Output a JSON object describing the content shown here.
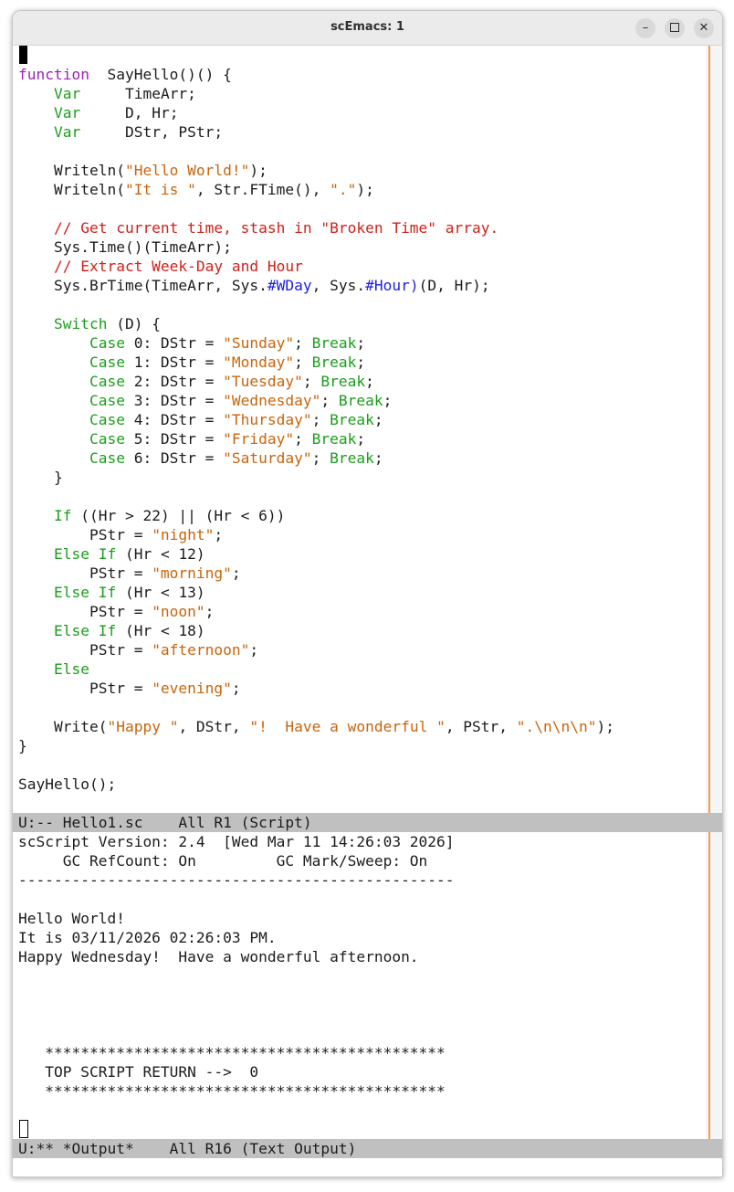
{
  "window": {
    "title": "scEmacs: 1"
  },
  "editor": {
    "lines": [
      [],
      [
        [
          "kw",
          "function"
        ],
        [
          "",
          "  SayHello()() {"
        ]
      ],
      [
        [
          "",
          "    "
        ],
        [
          "ty",
          "Var"
        ],
        [
          "",
          "     TimeArr;"
        ]
      ],
      [
        [
          "",
          "    "
        ],
        [
          "ty",
          "Var"
        ],
        [
          "",
          "     D, Hr;"
        ]
      ],
      [
        [
          "",
          "    "
        ],
        [
          "ty",
          "Var"
        ],
        [
          "",
          "     DStr, PStr;"
        ]
      ],
      [],
      [
        [
          "",
          "    Writeln("
        ],
        [
          "st",
          "\"Hello World!\""
        ],
        [
          "",
          ");"
        ]
      ],
      [
        [
          "",
          "    Writeln("
        ],
        [
          "st",
          "\"It is \""
        ],
        [
          "",
          ", Str.FTime(), "
        ],
        [
          "st",
          "\".\""
        ],
        [
          "",
          ");"
        ]
      ],
      [],
      [
        [
          "",
          "    "
        ],
        [
          "cm",
          "// Get current time, stash in \"Broken Time\" array."
        ]
      ],
      [
        [
          "",
          "    Sys.Time()(TimeArr);"
        ]
      ],
      [
        [
          "",
          "    "
        ],
        [
          "cm",
          "// Extract Week-Day and Hour"
        ]
      ],
      [
        [
          "",
          "    Sys.BrTime(TimeArr, Sys."
        ],
        [
          "sy",
          "#WDay"
        ],
        [
          "",
          ", Sys."
        ],
        [
          "sy",
          "#Hour)"
        ],
        [
          "",
          "(D, Hr);"
        ]
      ],
      [],
      [
        [
          "",
          "    "
        ],
        [
          "ty",
          "Switch"
        ],
        [
          "",
          " (D) {"
        ]
      ],
      [
        [
          "",
          "        "
        ],
        [
          "ty",
          "Case"
        ],
        [
          "",
          " 0: DStr = "
        ],
        [
          "st",
          "\"Sunday\""
        ],
        [
          "",
          "; "
        ],
        [
          "ty",
          "Break"
        ],
        [
          "",
          ";"
        ]
      ],
      [
        [
          "",
          "        "
        ],
        [
          "ty",
          "Case"
        ],
        [
          "",
          " 1: DStr = "
        ],
        [
          "st",
          "\"Monday\""
        ],
        [
          "",
          "; "
        ],
        [
          "ty",
          "Break"
        ],
        [
          "",
          ";"
        ]
      ],
      [
        [
          "",
          "        "
        ],
        [
          "ty",
          "Case"
        ],
        [
          "",
          " 2: DStr = "
        ],
        [
          "st",
          "\"Tuesday\""
        ],
        [
          "",
          "; "
        ],
        [
          "ty",
          "Break"
        ],
        [
          "",
          ";"
        ]
      ],
      [
        [
          "",
          "        "
        ],
        [
          "ty",
          "Case"
        ],
        [
          "",
          " 3: DStr = "
        ],
        [
          "st",
          "\"Wednesday\""
        ],
        [
          "",
          "; "
        ],
        [
          "ty",
          "Break"
        ],
        [
          "",
          ";"
        ]
      ],
      [
        [
          "",
          "        "
        ],
        [
          "ty",
          "Case"
        ],
        [
          "",
          " 4: DStr = "
        ],
        [
          "st",
          "\"Thursday\""
        ],
        [
          "",
          "; "
        ],
        [
          "ty",
          "Break"
        ],
        [
          "",
          ";"
        ]
      ],
      [
        [
          "",
          "        "
        ],
        [
          "ty",
          "Case"
        ],
        [
          "",
          " 5: DStr = "
        ],
        [
          "st",
          "\"Friday\""
        ],
        [
          "",
          "; "
        ],
        [
          "ty",
          "Break"
        ],
        [
          "",
          ";"
        ]
      ],
      [
        [
          "",
          "        "
        ],
        [
          "ty",
          "Case"
        ],
        [
          "",
          " 6: DStr = "
        ],
        [
          "st",
          "\"Saturday\""
        ],
        [
          "",
          "; "
        ],
        [
          "ty",
          "Break"
        ],
        [
          "",
          ";"
        ]
      ],
      [
        [
          "",
          "    }"
        ]
      ],
      [],
      [
        [
          "",
          "    "
        ],
        [
          "ty",
          "If"
        ],
        [
          "",
          " ((Hr > 22) || (Hr < 6))"
        ]
      ],
      [
        [
          "",
          "        PStr = "
        ],
        [
          "st",
          "\"night\""
        ],
        [
          "",
          ";"
        ]
      ],
      [
        [
          "",
          "    "
        ],
        [
          "ty",
          "Else If"
        ],
        [
          "",
          " (Hr < 12)"
        ]
      ],
      [
        [
          "",
          "        PStr = "
        ],
        [
          "st",
          "\"morning\""
        ],
        [
          "",
          ";"
        ]
      ],
      [
        [
          "",
          "    "
        ],
        [
          "ty",
          "Else If"
        ],
        [
          "",
          " (Hr < 13)"
        ]
      ],
      [
        [
          "",
          "        PStr = "
        ],
        [
          "st",
          "\"noon\""
        ],
        [
          "",
          ";"
        ]
      ],
      [
        [
          "",
          "    "
        ],
        [
          "ty",
          "Else If"
        ],
        [
          "",
          " (Hr < 18)"
        ]
      ],
      [
        [
          "",
          "        PStr = "
        ],
        [
          "st",
          "\"afternoon\""
        ],
        [
          "",
          ";"
        ]
      ],
      [
        [
          "",
          "    "
        ],
        [
          "ty",
          "Else"
        ]
      ],
      [
        [
          "",
          "        PStr = "
        ],
        [
          "st",
          "\"evening\""
        ],
        [
          "",
          ";"
        ]
      ],
      [],
      [
        [
          "",
          "    Write("
        ],
        [
          "st",
          "\"Happy \""
        ],
        [
          "",
          ", DStr, "
        ],
        [
          "st",
          "\"!  Have a wonderful \""
        ],
        [
          "",
          ", PStr, "
        ],
        [
          "st",
          "\".\\n\\n\\n\""
        ],
        [
          "",
          ");"
        ]
      ],
      [
        [
          "",
          "}"
        ]
      ],
      [],
      [
        [
          "",
          "SayHello();"
        ]
      ]
    ],
    "modeline": "U:-- Hello1.sc    All R1 (Script)"
  },
  "output": {
    "lines": [
      "scScript Version: 2.4  [Wed Mar 11 14:26:03 2026]",
      "     GC RefCount: On         GC Mark/Sweep: On",
      "-------------------------------------------------",
      "",
      "Hello World!",
      "It is 03/11/2026 02:26:03 PM.",
      "Happy Wednesday!  Have a wonderful afternoon.",
      "",
      "",
      "",
      "",
      "   *********************************************",
      "   TOP SCRIPT RETURN -->  0",
      "   *********************************************"
    ],
    "modeline": "U:** *Output*    All R16 (Text Output)"
  },
  "colors": {
    "keyword": "#9b22b6",
    "type": "#1a9e1a",
    "string": "#c8650d",
    "comment": "#d0201a",
    "symbol": "#1f1fe0",
    "modeline_bg": "#c0c0c0",
    "scrollbar_accent": "#f0a050"
  },
  "icons": [
    "minimize-icon",
    "maximize-icon",
    "close-icon"
  ]
}
